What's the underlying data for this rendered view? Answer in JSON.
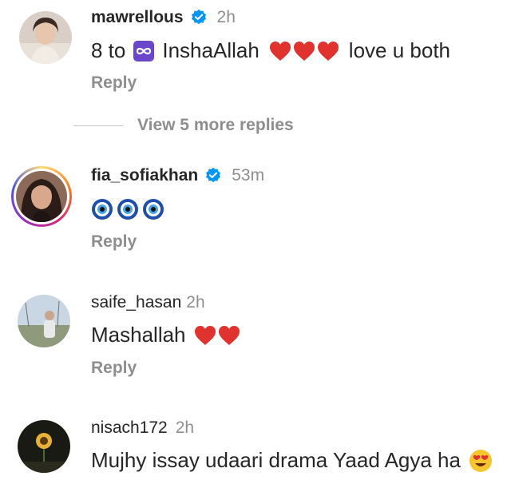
{
  "comments": [
    {
      "username": "mawrellous",
      "verified": true,
      "time": "2h",
      "text_parts": [
        "8 to",
        "InshaAllah",
        "love u both"
      ],
      "icons": [
        "infinity-emoji",
        "red-heart-emoji",
        "red-heart-emoji",
        "red-heart-emoji"
      ],
      "reply_label": "Reply"
    },
    {
      "username": "fia_sofiakhan",
      "verified": true,
      "time": "53m",
      "icons": [
        "nazar-amulet-emoji",
        "nazar-amulet-emoji",
        "nazar-amulet-emoji"
      ],
      "reply_label": "Reply"
    },
    {
      "username": "saife_hasan",
      "verified": false,
      "time": "2h",
      "text": "Mashallah",
      "icons": [
        "red-heart-emoji",
        "red-heart-emoji"
      ],
      "reply_label": "Reply"
    },
    {
      "username": "nisach172",
      "verified": false,
      "time": "2h",
      "text": "Mujhy issay udaari drama Yaad Agya ha",
      "icons": [
        "heart-eyes-emoji"
      ]
    }
  ],
  "view_more": {
    "label": "View 5 more replies"
  },
  "colors": {
    "verified_blue": "#0095f6",
    "muted_text": "#8e8e8e",
    "heart_red": "#e0322e"
  }
}
